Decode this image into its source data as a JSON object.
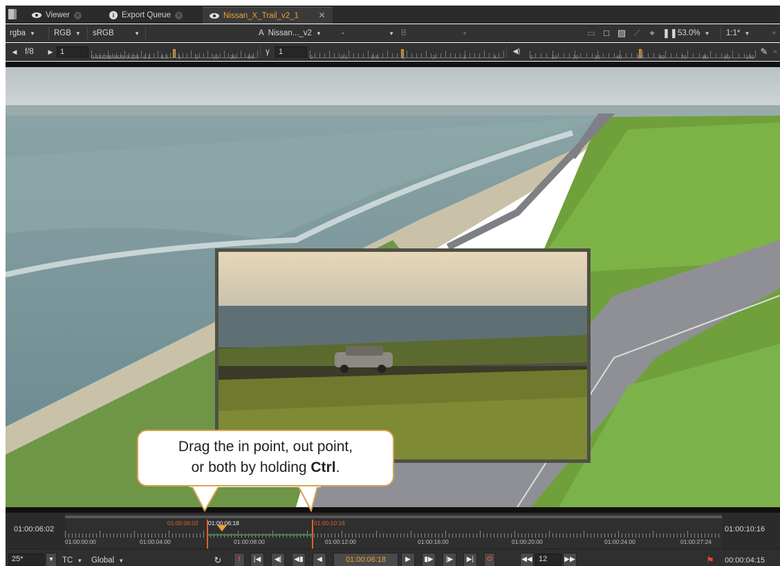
{
  "tabs": [
    {
      "label": "Viewer"
    },
    {
      "label": "Export Queue"
    },
    {
      "label": "Nissan_X_Trail_v2_1"
    }
  ],
  "toolbar": {
    "channels": "rgba",
    "display": "RGB",
    "colorspace": "sRGB",
    "input_a_prefix": "A",
    "input_a": "Nissan..._v2",
    "compare_mode": "-",
    "input_b_prefix": "B",
    "zoom": "53.0%",
    "proxy": "1:1*"
  },
  "exposure": {
    "label": "f/8",
    "value": "1",
    "scale": [
      "0.03125",
      "0.0625",
      "0.125",
      "0.1",
      "0.2",
      "1",
      "2",
      "10",
      "20",
      "64"
    ]
  },
  "gamma": {
    "label": "γ",
    "value": "1",
    "scale": [
      "0",
      "0.1",
      "0.5",
      "1",
      "2",
      "3",
      "4"
    ]
  },
  "volume": {
    "scale": [
      "0",
      "10",
      "20",
      "30",
      "40",
      "50",
      "60",
      "70",
      "80",
      "90",
      "100"
    ]
  },
  "callout": {
    "line1": "Drag the in point, out point,",
    "line2_prefix": "or both by holding ",
    "line2_key": "Ctrl",
    "line2_suffix": "."
  },
  "timeline": {
    "current_left": "01:00:06:02",
    "end_right": "01:00:10:16",
    "in_point": "01:00:06:02",
    "playhead": "01:00:06:18",
    "out_point": "01:00:10:16",
    "ruler_labels": [
      "01:00:00:00",
      "01:00:04:00",
      "01:00:08:00",
      "01:00:12:00",
      "01:00:16:00",
      "01:00:20:00",
      "01:00:24:00",
      "01:00:27:24"
    ]
  },
  "controls": {
    "fps": "25*",
    "timecode_mode": "TC",
    "scope": "Global",
    "in_marker": "I",
    "current_time": "01:00:06:18",
    "out_marker": "O",
    "step": "12",
    "duration": "00:00:04:15"
  }
}
